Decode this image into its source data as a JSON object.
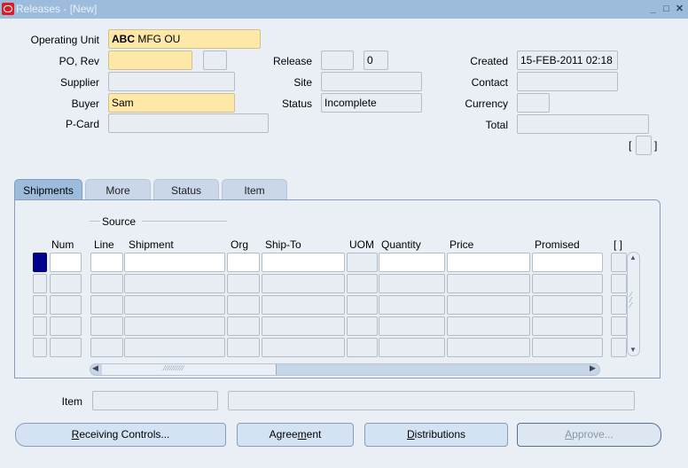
{
  "window": {
    "title": "Releases - [New]",
    "controls": [
      "minimize",
      "maximize",
      "close"
    ]
  },
  "header": {
    "operating_unit": {
      "label": "Operating Unit",
      "value": "ABC MFG OU"
    },
    "po_rev": {
      "label": "PO, Rev",
      "po_value": "",
      "rev_value": ""
    },
    "supplier": {
      "label": "Supplier",
      "value": ""
    },
    "buyer": {
      "label": "Buyer",
      "value": "Sam"
    },
    "pcard": {
      "label": "P-Card",
      "value": ""
    },
    "release": {
      "label": "Release",
      "num_value": "",
      "rev_value": "0"
    },
    "site": {
      "label": "Site",
      "value": ""
    },
    "status": {
      "label": "Status",
      "value": "Incomplete"
    },
    "created": {
      "label": "Created",
      "value": "15-FEB-2011 02:18"
    },
    "contact": {
      "label": "Contact",
      "value": ""
    },
    "currency": {
      "label": "Currency",
      "value": ""
    },
    "total": {
      "label": "Total",
      "value": ""
    },
    "dff": {
      "open": "[",
      "close": "]"
    }
  },
  "tabs": [
    {
      "label": "Shipments",
      "active": true
    },
    {
      "label": "More",
      "active": false
    },
    {
      "label": "Status",
      "active": false
    },
    {
      "label": "Item",
      "active": false
    }
  ],
  "shipments": {
    "group_label": "Source",
    "columns": [
      "Num",
      "Line",
      "Shipment",
      "Org",
      "Ship-To",
      "UOM",
      "Quantity",
      "Price",
      "Promised"
    ],
    "dff_header": "[ ]",
    "row_count": 5,
    "rows": [
      [
        "",
        "",
        "",
        "",
        "",
        "",
        "",
        "",
        ""
      ],
      [
        "",
        "",
        "",
        "",
        "",
        "",
        "",
        "",
        ""
      ],
      [
        "",
        "",
        "",
        "",
        "",
        "",
        "",
        "",
        ""
      ],
      [
        "",
        "",
        "",
        "",
        "",
        "",
        "",
        "",
        ""
      ],
      [
        "",
        "",
        "",
        "",
        "",
        "",
        "",
        "",
        ""
      ]
    ]
  },
  "item": {
    "label": "Item",
    "code": "",
    "description": ""
  },
  "buttons": {
    "receiving_controls": {
      "pre": "",
      "mnemonic": "R",
      "post": "eceiving Controls..."
    },
    "agreement": {
      "pre": "Agree",
      "mnemonic": "m",
      "post": "ent"
    },
    "distributions": {
      "pre": "",
      "mnemonic": "D",
      "post": "istributions"
    },
    "approve": {
      "pre": "",
      "mnemonic": "A",
      "post": "pprove..."
    }
  }
}
